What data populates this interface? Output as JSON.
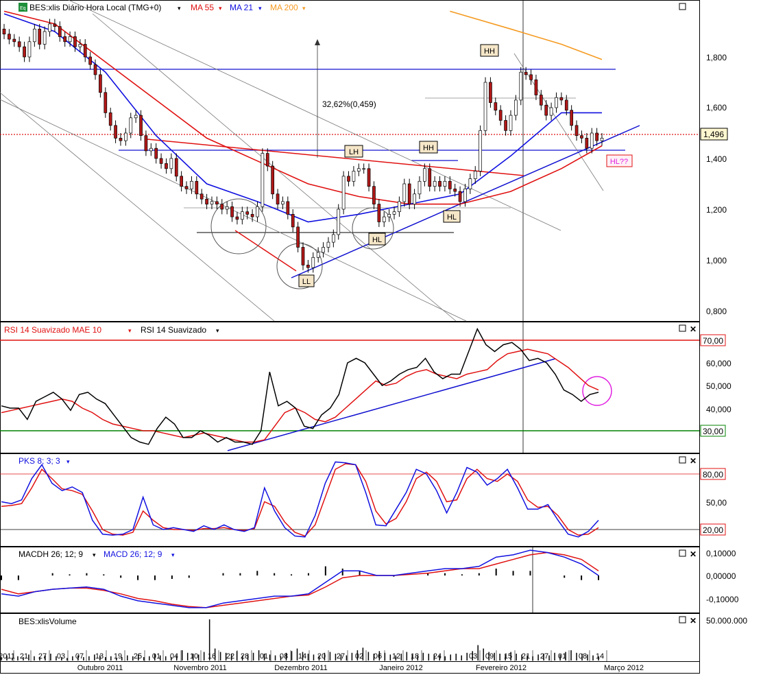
{
  "colors": {
    "price_up": "#ffffff",
    "price_down": "#b01818",
    "ma55": "#e01010",
    "ma21": "#1010e0",
    "ma200": "#f59a20",
    "trend_blue": "#1010d0",
    "trend_red": "#e01010",
    "rsi_line": "#000000",
    "rsi_mae": "#e01010",
    "level_red": "#e01010",
    "level_green": "#008000",
    "pks_k": "#1010e0",
    "pks_d": "#e01010",
    "circle_hl": "#e020e0",
    "tag_fill": "#f5e6c8",
    "price_tag_fill": "#fff7d0"
  },
  "panels": {
    "price": {
      "legend_prefix_icon": "equity-icon",
      "legend_ticker": "BES:xlis Diário Hora Local (TMG+0)",
      "legend_ma55": "MA 55",
      "legend_ma21": "MA 21",
      "legend_ma200": "MA 200",
      "axis_ticks": [
        "1,800",
        "1,600",
        "1,400",
        "1,200",
        "1,000",
        "0,800"
      ],
      "current_price": "1,496",
      "move_annotation": "32,62%(0,459)",
      "tags": [
        "HH",
        "LH",
        "HH",
        "HL",
        "HL",
        "LL",
        "HL??"
      ]
    },
    "rsi": {
      "legend_mae": "RSI 14 Suavizado MAE 10",
      "legend_rsi": "RSI 14 Suavizado",
      "axis_ticks": [
        "70,00",
        "60,000",
        "50,000",
        "40,000",
        "30,00"
      ]
    },
    "pks": {
      "legend": "PKS 8; 3; 3",
      "axis_ticks": [
        "80,00",
        "50,00",
        "20,00"
      ]
    },
    "macd": {
      "legend_hist": "MACDH 26; 12; 9",
      "legend_macd": "MACD 26; 12; 9",
      "axis_ticks": [
        "0,10000",
        "0,00000",
        "-0,10000"
      ]
    },
    "volume": {
      "legend": "BES:xlisVolume",
      "axis_ticks": [
        "50.000.000"
      ]
    }
  },
  "chart_data": {
    "type": "candlestick",
    "title": "BES:xlis Diário Hora Local (TMG+0)",
    "x_day_labels": [
      "2011",
      "21",
      "27",
      "03",
      "07",
      "13",
      "19",
      "25",
      "01",
      "04",
      "10",
      "16",
      "22",
      "28",
      "01",
      "08",
      "14",
      "20",
      "27",
      "02",
      "06",
      "12",
      "18",
      "24",
      "03",
      "09",
      "15",
      "21",
      "27",
      "01",
      "08",
      "14"
    ],
    "x_month_labels": [
      "Outubro 2011",
      "Novembro 2011",
      "Dezembro 2011",
      "Janeiro 2012",
      "Fevereiro 2012",
      "Março 2012"
    ],
    "price_axis": {
      "ylim": [
        0.75,
        1.98
      ],
      "ticks": [
        1.8,
        1.6,
        1.4,
        1.2,
        1.0,
        0.8
      ]
    },
    "closes": [
      1.89,
      1.87,
      1.86,
      1.84,
      1.8,
      1.86,
      1.91,
      1.85,
      1.9,
      1.93,
      1.92,
      1.88,
      1.86,
      1.88,
      1.84,
      1.85,
      1.8,
      1.77,
      1.73,
      1.66,
      1.58,
      1.53,
      1.48,
      1.47,
      1.5,
      1.56,
      1.57,
      1.49,
      1.43,
      1.44,
      1.4,
      1.38,
      1.36,
      1.4,
      1.33,
      1.29,
      1.28,
      1.31,
      1.26,
      1.24,
      1.22,
      1.23,
      1.22,
      1.2,
      1.21,
      1.17,
      1.16,
      1.19,
      1.18,
      1.17,
      1.21,
      1.42,
      1.37,
      1.26,
      1.22,
      1.23,
      1.18,
      1.13,
      1.05,
      0.98,
      0.97,
      1.01,
      1.03,
      1.05,
      1.07,
      1.1,
      1.2,
      1.33,
      1.31,
      1.35,
      1.36,
      1.36,
      1.29,
      1.22,
      1.15,
      1.17,
      1.18,
      1.19,
      1.23,
      1.3,
      1.22,
      1.26,
      1.31,
      1.36,
      1.29,
      1.31,
      1.29,
      1.31,
      1.28,
      1.27,
      1.23,
      1.28,
      1.32,
      1.35,
      1.51,
      1.7,
      1.62,
      1.59,
      1.55,
      1.51,
      1.57,
      1.63,
      1.74,
      1.73,
      1.71,
      1.65,
      1.61,
      1.57,
      1.6,
      1.64,
      1.63,
      1.59,
      1.53,
      1.49,
      1.48,
      1.44,
      1.5,
      1.47,
      1.48
    ],
    "moving_averages": [
      {
        "name": "MA 55",
        "x_index": [
          0,
          10,
          20,
          30,
          40,
          50,
          60,
          70,
          80,
          90,
          100,
          110,
          118
        ],
        "values": [
          1.98,
          1.93,
          1.78,
          1.63,
          1.48,
          1.39,
          1.3,
          1.25,
          1.22,
          1.22,
          1.27,
          1.36,
          1.45
        ]
      },
      {
        "name": "MA 21",
        "x_index": [
          0,
          10,
          20,
          30,
          40,
          50,
          60,
          70,
          80,
          90,
          100,
          110,
          118
        ],
        "values": [
          1.97,
          1.9,
          1.74,
          1.49,
          1.3,
          1.23,
          1.15,
          1.18,
          1.22,
          1.26,
          1.41,
          1.58,
          1.58
        ]
      },
      {
        "name": "MA 200",
        "x_index": [
          88,
          100,
          110,
          118
        ],
        "values": [
          1.98,
          1.91,
          1.85,
          1.79
        ]
      }
    ],
    "rsi": {
      "ylim": [
        20,
        80
      ],
      "levels": [
        70,
        30
      ],
      "rsi_14": [
        41,
        40,
        40,
        35,
        43,
        45,
        47,
        44,
        39,
        46,
        47,
        44,
        42,
        37,
        32,
        27,
        25,
        24,
        31,
        36,
        33,
        27,
        27,
        30,
        28,
        25,
        27,
        25,
        25,
        24,
        30,
        56,
        41,
        43,
        40,
        32,
        31,
        37,
        40,
        46,
        60,
        62,
        60,
        55,
        50,
        52,
        55,
        57,
        58,
        62,
        56,
        53,
        55,
        55,
        65,
        75,
        68,
        65,
        68,
        69,
        66,
        61,
        62,
        60,
        55,
        48,
        46,
        43,
        46,
        47
      ],
      "rsi_14_mae_10": [
        38,
        39,
        40,
        41,
        42,
        43,
        44,
        43,
        40,
        38,
        35,
        33,
        32,
        31,
        30,
        30,
        29,
        28,
        27,
        28,
        29,
        28,
        27,
        26,
        25,
        25,
        26,
        32,
        38,
        40,
        38,
        35,
        34,
        36,
        40,
        44,
        48,
        52,
        50,
        51,
        54,
        56,
        57,
        55,
        54,
        53,
        55,
        56,
        57,
        61,
        64,
        65,
        66,
        65,
        64,
        61,
        58,
        54,
        50,
        48
      ]
    },
    "pks": {
      "ylim": [
        0,
        100
      ],
      "levels": [
        80,
        20
      ],
      "k": [
        50,
        48,
        52,
        75,
        90,
        70,
        62,
        66,
        60,
        30,
        15,
        14,
        15,
        20,
        55,
        25,
        20,
        22,
        20,
        18,
        24,
        20,
        25,
        20,
        18,
        22,
        65,
        40,
        22,
        13,
        12,
        35,
        70,
        93,
        92,
        90,
        60,
        25,
        24,
        42,
        60,
        85,
        80,
        62,
        38,
        60,
        87,
        82,
        68,
        75,
        85,
        65,
        42,
        42,
        47,
        30,
        15,
        12,
        18,
        30
      ],
      "d": [
        45,
        46,
        48,
        65,
        85,
        75,
        64,
        62,
        58,
        40,
        20,
        15,
        14,
        17,
        40,
        30,
        22,
        20,
        20,
        19,
        21,
        21,
        22,
        20,
        19,
        21,
        50,
        45,
        28,
        17,
        13,
        25,
        55,
        85,
        91,
        90,
        72,
        40,
        26,
        32,
        50,
        75,
        82,
        72,
        50,
        52,
        75,
        85,
        75,
        72,
        80,
        72,
        52,
        44,
        45,
        35,
        20,
        14,
        15,
        22
      ]
    },
    "macd": {
      "ylim": [
        -0.15,
        0.12
      ],
      "macd": [
        -0.08,
        -0.09,
        -0.07,
        -0.06,
        -0.055,
        -0.05,
        -0.06,
        -0.09,
        -0.11,
        -0.12,
        -0.13,
        -0.14,
        -0.14,
        -0.12,
        -0.11,
        -0.1,
        -0.09,
        -0.09,
        -0.08,
        -0.03,
        0.02,
        0.02,
        0.0,
        0.0,
        0.01,
        0.02,
        0.03,
        0.03,
        0.04,
        0.08,
        0.09,
        0.11,
        0.1,
        0.08,
        0.05,
        0.0
      ],
      "signal": [
        -0.06,
        -0.08,
        -0.07,
        -0.06,
        -0.055,
        -0.055,
        -0.065,
        -0.08,
        -0.1,
        -0.11,
        -0.125,
        -0.135,
        -0.14,
        -0.13,
        -0.12,
        -0.11,
        -0.1,
        -0.09,
        -0.085,
        -0.05,
        -0.01,
        0.0,
        0.0,
        0.0,
        0.005,
        0.01,
        0.02,
        0.03,
        0.03,
        0.05,
        0.07,
        0.09,
        0.1,
        0.09,
        0.07,
        0.02
      ],
      "histogram_levels": [
        -0.02,
        -0.02,
        0.0,
        0.01,
        0.005,
        0.01,
        0.005,
        -0.01,
        -0.02,
        -0.02,
        -0.015,
        -0.01,
        0.0,
        0.01,
        0.01,
        0.02,
        0.01,
        0.005,
        0.01,
        0.04,
        0.03,
        0.02,
        0.0,
        -0.005,
        0.0,
        0.01,
        0.01,
        0.005,
        0.01,
        0.03,
        0.02,
        0.02,
        0.0,
        -0.01,
        -0.02,
        -0.02
      ]
    },
    "volume": {
      "ylim": [
        0,
        60000000
      ],
      "values": [
        4,
        6,
        3,
        5,
        4,
        7,
        5,
        4,
        6,
        8,
        5,
        4,
        3,
        5,
        6,
        4,
        5,
        7,
        6,
        4,
        5,
        3,
        4,
        6,
        5,
        7,
        4,
        5,
        8,
        6,
        5,
        4,
        6,
        12,
        9,
        8,
        7,
        10,
        48,
        14,
        10,
        9,
        8,
        11,
        6,
        7,
        9,
        12,
        8,
        7,
        6,
        5,
        9,
        11,
        14,
        10,
        8,
        7,
        6,
        9,
        10,
        8,
        7,
        6,
        9,
        12,
        15,
        10,
        8,
        11,
        9,
        7,
        6,
        8,
        10,
        7,
        6,
        9,
        8,
        7,
        6,
        5,
        7,
        8,
        6,
        9,
        11,
        18,
        14,
        10,
        9,
        8,
        7,
        10,
        8,
        7,
        6,
        5,
        7,
        8,
        6,
        9,
        7,
        10,
        12,
        9,
        8,
        7,
        6,
        5
      ]
    }
  }
}
